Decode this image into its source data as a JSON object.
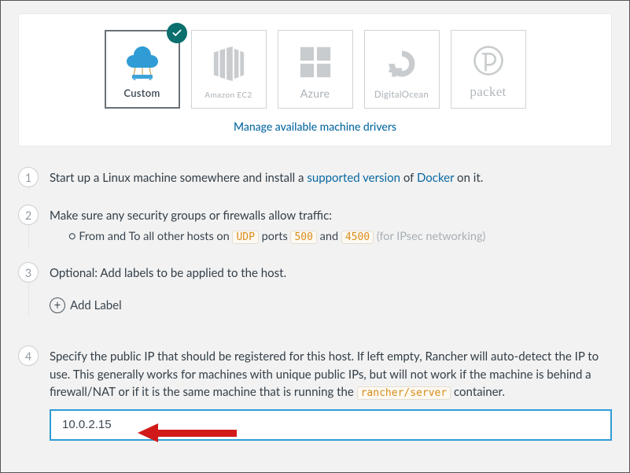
{
  "drivers": {
    "custom": "Custom",
    "amazon": "Amazon EC2",
    "azure": "Azure",
    "digitalocean": "DigitalOcean",
    "packet": "packet"
  },
  "manage_link": "Manage available machine drivers",
  "steps": {
    "s1": {
      "num": "1",
      "pre": "Start up a Linux machine somewhere and install a ",
      "link1": "supported version",
      "mid": " of ",
      "link2": "Docker",
      "post": " on it."
    },
    "s2": {
      "num": "2",
      "text": "Make sure any security groups or firewalls allow traffic:",
      "bullet_pre": "From and To all other hosts on ",
      "udp": "UDP",
      "ports_word": " ports ",
      "p1": "500",
      "and": " and ",
      "p2": "4500",
      "paren": "  (for IPsec networking)"
    },
    "s3": {
      "num": "3",
      "text": "Optional: Add labels to be applied to the host.",
      "add_label": "Add Label"
    },
    "s4": {
      "num": "4",
      "pre": "Specify the public IP that should be registered for this host. If left empty, Rancher will auto-detect the IP to use. This generally works for machines with unique public IPs, but will not work if the machine is behind a firewall/NAT or if it is the same machine that is running the ",
      "code": "rancher/server",
      "post": " container.",
      "ip_value": "10.0.2.15"
    }
  }
}
